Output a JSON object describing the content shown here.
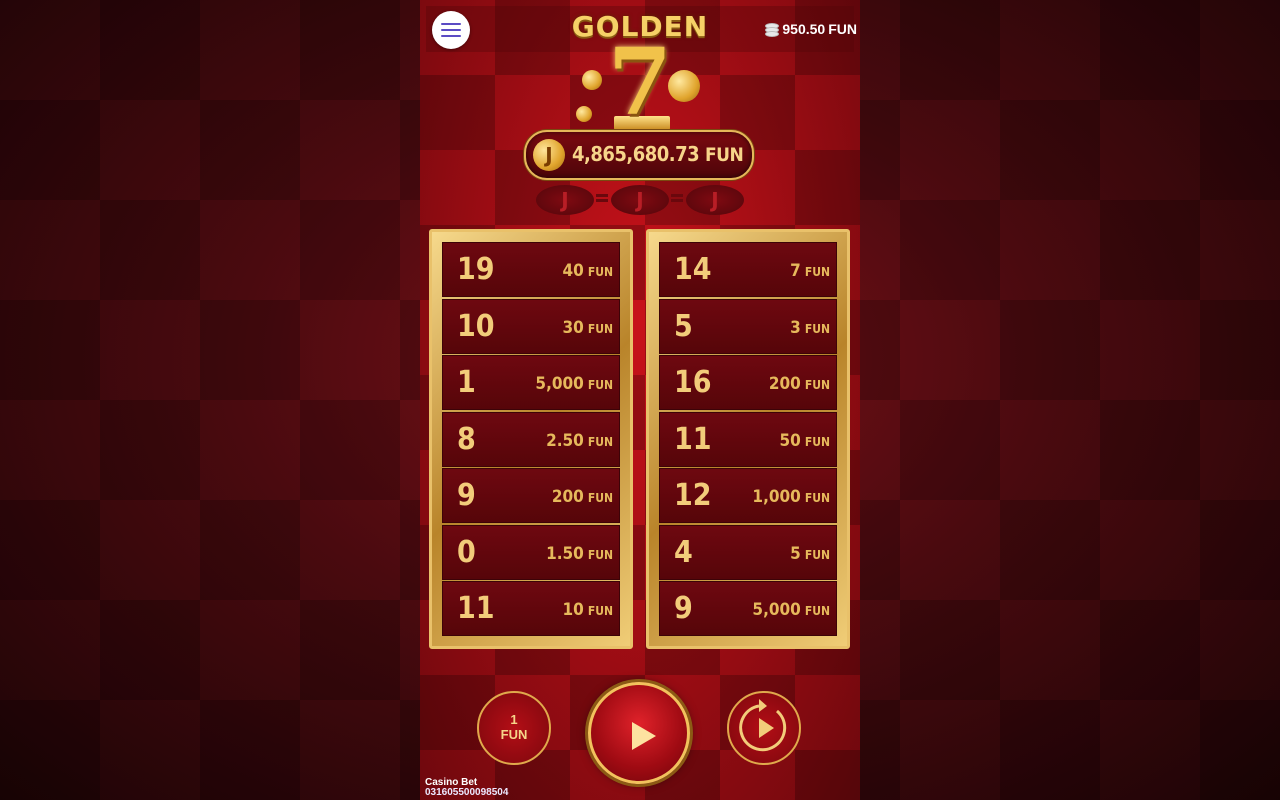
{
  "balance": {
    "value": "950.50",
    "unit": "FUN"
  },
  "logo": {
    "title": "GOLDEN",
    "number": "7"
  },
  "jackpot": {
    "icon_letter": "J",
    "value": "4,865,680.73",
    "unit": "FUN"
  },
  "j_tokens": [
    "J",
    "J",
    "J"
  ],
  "tickets": {
    "left": [
      {
        "number": "19",
        "prize": "40",
        "unit": "FUN"
      },
      {
        "number": "10",
        "prize": "30",
        "unit": "FUN"
      },
      {
        "number": "1",
        "prize": "5,000",
        "unit": "FUN"
      },
      {
        "number": "8",
        "prize": "2.50",
        "unit": "FUN"
      },
      {
        "number": "9",
        "prize": "200",
        "unit": "FUN"
      },
      {
        "number": "0",
        "prize": "1.50",
        "unit": "FUN"
      },
      {
        "number": "11",
        "prize": "10",
        "unit": "FUN"
      }
    ],
    "right": [
      {
        "number": "14",
        "prize": "7",
        "unit": "FUN"
      },
      {
        "number": "5",
        "prize": "3",
        "unit": "FUN"
      },
      {
        "number": "16",
        "prize": "200",
        "unit": "FUN"
      },
      {
        "number": "11",
        "prize": "50",
        "unit": "FUN"
      },
      {
        "number": "12",
        "prize": "1,000",
        "unit": "FUN"
      },
      {
        "number": "4",
        "prize": "5",
        "unit": "FUN"
      },
      {
        "number": "9",
        "prize": "5,000",
        "unit": "FUN"
      }
    ]
  },
  "controls": {
    "bet_value": "1",
    "bet_unit": "FUN"
  },
  "footer": {
    "label": "Casino Bet",
    "id": "031605500098504"
  },
  "colors": {
    "gold": "#f2cc7a",
    "red": "#b30e16",
    "accent": "#5b4bc4"
  }
}
